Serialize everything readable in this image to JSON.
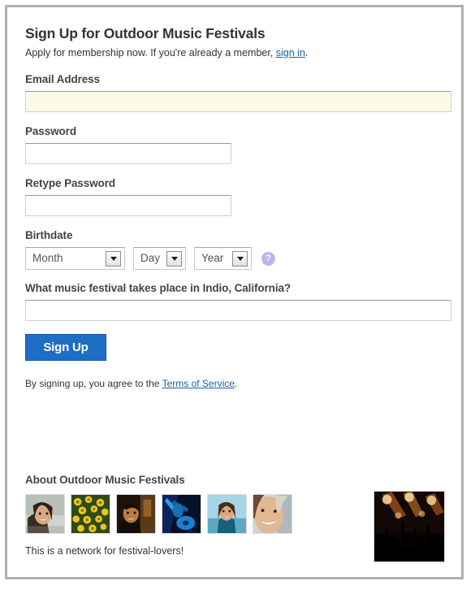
{
  "header": {
    "title": "Sign Up for Outdoor Music Festivals",
    "subtitle_prefix": "Apply for membership now. If you're already a member, ",
    "signin_link": "sign in",
    "subtitle_suffix": "."
  },
  "form": {
    "email": {
      "label": "Email Address",
      "value": "",
      "placeholder": ""
    },
    "password": {
      "label": "Password",
      "value": "",
      "placeholder": ""
    },
    "retype_password": {
      "label": "Retype Password",
      "value": "",
      "placeholder": ""
    },
    "birthdate": {
      "label": "Birthdate",
      "month": "Month",
      "day": "Day",
      "year": "Year",
      "help_icon": "question-mark-icon",
      "help_glyph": "?"
    },
    "security_question": {
      "label": "What music festival takes place in Indio, California?",
      "value": "",
      "placeholder": ""
    },
    "submit_label": "Sign Up",
    "tos_prefix": "By signing up, you agree to the ",
    "tos_link": "Terms of Service",
    "tos_suffix": "."
  },
  "about": {
    "title": "About Outdoor Music Festivals",
    "caption": "This is a network for festival-lovers!",
    "thumbnails": [
      {
        "name": "member-photo-smiling-woman",
        "alt": "smiling woman with dark hair"
      },
      {
        "name": "member-photo-yellow-flowers",
        "alt": "yellow flowers"
      },
      {
        "name": "member-photo-man-indoors",
        "alt": "man smiling indoors"
      },
      {
        "name": "member-photo-guitarist",
        "alt": "guitarist in blue light"
      },
      {
        "name": "member-photo-woman-outdoors",
        "alt": "woman outdoors"
      },
      {
        "name": "member-photo-woman-closeup",
        "alt": "woman closeup selfie"
      }
    ],
    "hero": {
      "name": "concert-crowd-photo",
      "alt": "concert crowd with stage lights"
    }
  },
  "colors": {
    "accent_blue": "#1c6fc4",
    "link_blue": "#1a5fa8",
    "autofill_yellow": "#fcfce6",
    "help_purple": "#b9b9e8",
    "frame_gray": "#b0b0b0"
  }
}
